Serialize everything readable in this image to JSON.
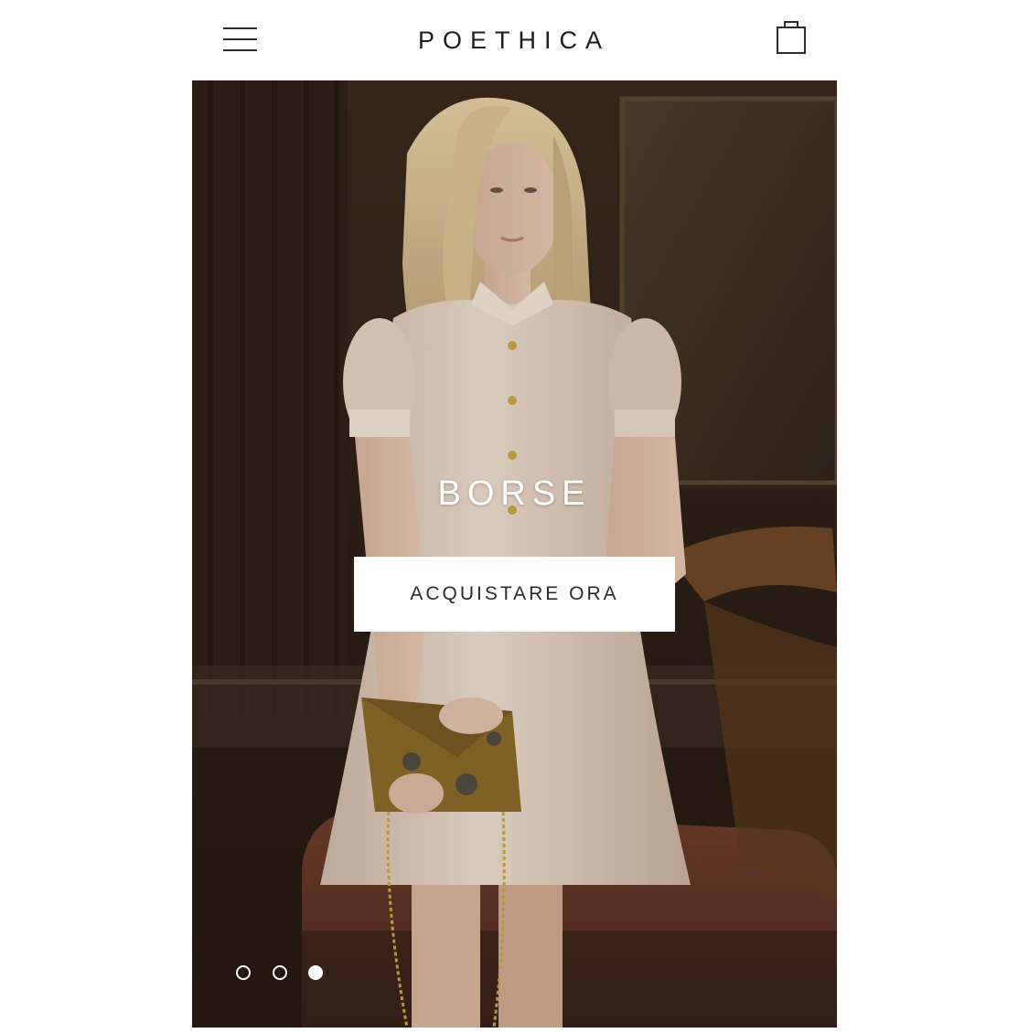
{
  "header": {
    "brand": "POETHICA",
    "menu_icon": "hamburger-menu-icon",
    "cart_icon": "shopping-bag-icon"
  },
  "hero": {
    "title": "BORSE",
    "cta_label": "ACQUISTARE ORA",
    "carousel": {
      "total_slides": 3,
      "active_slide": 3
    }
  },
  "colors": {
    "text_dark": "#1e1e1e",
    "button_bg": "#ffffff",
    "overlay_text": "#ffffff"
  }
}
